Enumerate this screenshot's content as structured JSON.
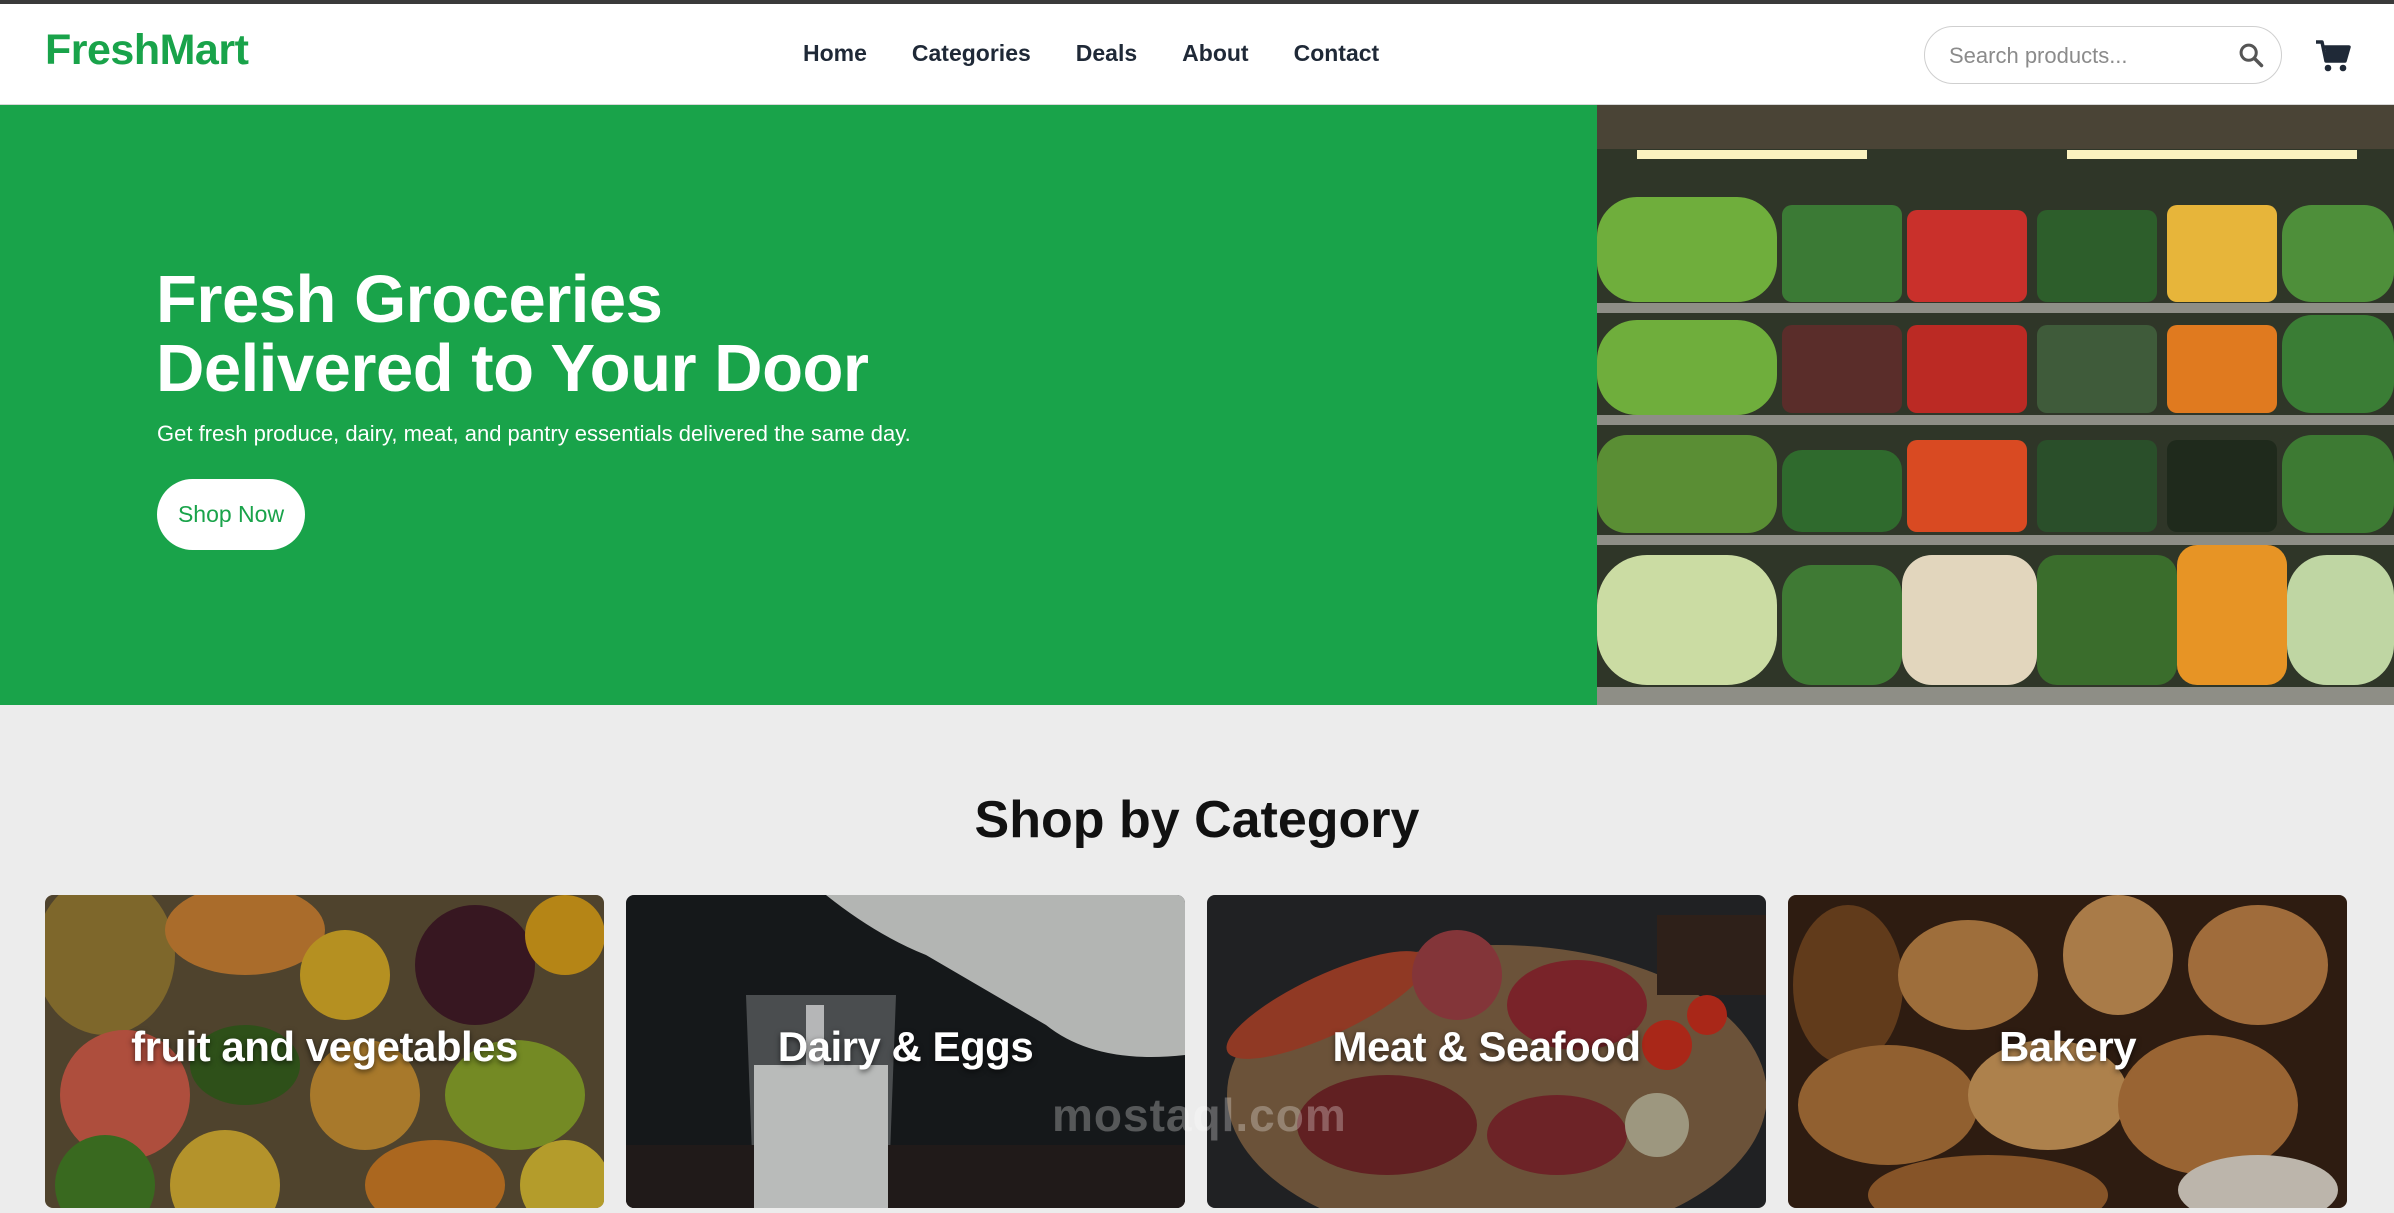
{
  "brand": {
    "name": "FreshMart",
    "color": "#19a34a"
  },
  "nav": [
    "Home",
    "Categories",
    "Deals",
    "About",
    "Contact"
  ],
  "search": {
    "placeholder": "Search products...",
    "icon": "search-icon"
  },
  "cart": {
    "icon": "cart-icon"
  },
  "hero": {
    "title_line1": "Fresh Groceries",
    "title_line2": "Delivered to Your Door",
    "subtitle": "Get fresh produce, dairy, meat, and pantry essentials delivered the same day.",
    "cta": "Shop Now",
    "image": "supermarket-produce-shelves-image"
  },
  "categories": {
    "title": "Shop by Category",
    "items": [
      {
        "label": "fruit and vegetables",
        "image": "fruit-image"
      },
      {
        "label": "Dairy & Eggs",
        "image": "milk-image"
      },
      {
        "label": "Meat & Seafood",
        "image": "meat-image"
      },
      {
        "label": "Bakery",
        "image": "bread-image"
      }
    ]
  },
  "watermark": "mostaql.com"
}
